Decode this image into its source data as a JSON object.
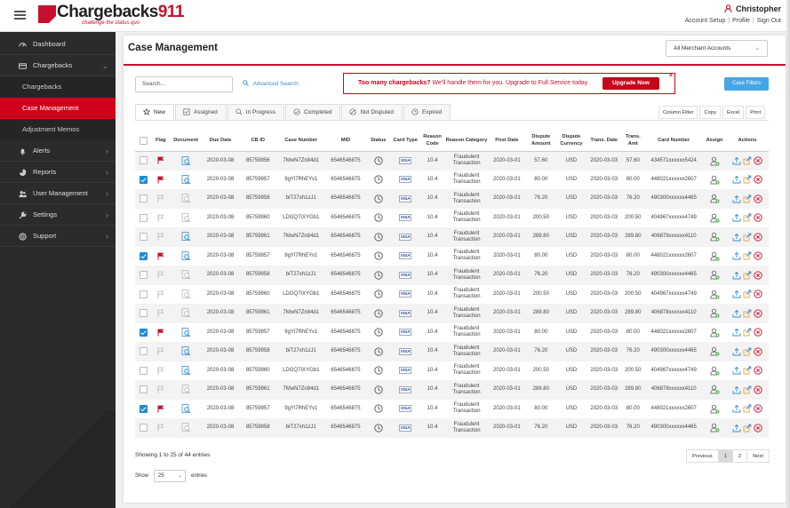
{
  "header": {
    "logo_text_a": "Chargebacks",
    "logo_text_b": "911",
    "logo_tagline": "challenge the status quo",
    "user_name": "Christopher",
    "links": [
      "Account Setup",
      "Profile",
      "Sign Out"
    ]
  },
  "sidebar": {
    "items": [
      {
        "label": "Dashboard",
        "icon": "dashboard-icon",
        "chevron": false
      },
      {
        "label": "Chargebacks",
        "icon": "chargebacks-icon",
        "chevron": true,
        "expanded": true
      },
      {
        "label": "Alerts",
        "icon": "bell-icon",
        "chevron": true
      },
      {
        "label": "Reports",
        "icon": "pie-chart-icon",
        "chevron": true
      },
      {
        "label": "User Management",
        "icon": "users-icon",
        "chevron": true
      },
      {
        "label": "Settings",
        "icon": "wrench-icon",
        "chevron": true
      },
      {
        "label": "Support",
        "icon": "lifebuoy-icon",
        "chevron": true
      }
    ],
    "sub_items": [
      {
        "label": "Chargebacks",
        "active": false
      },
      {
        "label": "Case Management",
        "active": true
      },
      {
        "label": "Adjustment Memos",
        "active": false
      }
    ]
  },
  "page": {
    "title": "Case Management",
    "merchant_select": "All Merchant Accounts",
    "search_placeholder": "Search...",
    "advanced_search": "Advanced Search",
    "promo_bold": "Too many chargebacks?",
    "promo_text": "We'll handle them for you. Upgrade to Full Service today",
    "upgrade_button": "Upgrade Now",
    "case_filters_button": "Case Filters"
  },
  "tabs": [
    "New",
    "Assigned",
    "In Progress",
    "Completed",
    "Not Disputed",
    "Expired"
  ],
  "tools": [
    "Column Filter",
    "Copy",
    "Excel",
    "Print"
  ],
  "table": {
    "columns": [
      "",
      "Flag",
      "Document",
      "Due Date",
      "CB ID",
      "Case Number",
      "MID",
      "Status",
      "Card Type",
      "Reason Code",
      "Reason Category",
      "Post Date",
      "Dispute Amount",
      "Dispute Currency",
      "Trans. Date",
      "Trans. Amt",
      "Card Number",
      "Assign",
      "Actions"
    ],
    "rows": [
      {
        "checked": false,
        "flagged": true,
        "doc": true,
        "due": "2020-03-08",
        "cbid": "85759956",
        "case": "7MwN7Zn84d1",
        "mid": "6546546875",
        "card": "VISA",
        "rcode": "10.4",
        "rcat": "Fraudulent Transaction",
        "post": "2020-03-01",
        "amount": "57.60",
        "currency": "USD",
        "tdate": "2020-03-03",
        "tamt": "57.60",
        "cardnum": "434571xxxxxx5424"
      },
      {
        "checked": true,
        "flagged": true,
        "doc": true,
        "due": "2020-03-08",
        "cbid": "85759957",
        "case": "9gYl7RhEYv1",
        "mid": "6546546875",
        "card": "VISA",
        "rcode": "10.4",
        "rcat": "Fraudulent Transaction",
        "post": "2020-03-01",
        "amount": "80.00",
        "currency": "USD",
        "tdate": "2020-03-03",
        "tamt": "80.00",
        "cardnum": "448021xxxxxx2607"
      },
      {
        "checked": false,
        "flagged": false,
        "doc": false,
        "due": "2020-03-08",
        "cbid": "85759958",
        "case": "biT27xh1zJ1",
        "mid": "6546546875",
        "card": "VISA",
        "rcode": "10.4",
        "rcat": "Fraudulent Transaction",
        "post": "2020-03-01",
        "amount": "76.20",
        "currency": "USD",
        "tdate": "2020-03-03",
        "tamt": "76.20",
        "cardnum": "490300xxxxxx4465"
      },
      {
        "checked": false,
        "flagged": false,
        "doc": false,
        "due": "2020-03-08",
        "cbid": "85759960",
        "case": "LDGQ7IXYGb1",
        "mid": "6546546875",
        "card": "VISA",
        "rcode": "10.4",
        "rcat": "Fraudulent Transaction",
        "post": "2020-03-01",
        "amount": "200.50",
        "currency": "USD",
        "tdate": "2020-03-03",
        "tamt": "200.50",
        "cardnum": "404967xxxxxx4749"
      },
      {
        "checked": false,
        "flagged": false,
        "doc": true,
        "due": "2020-03-08",
        "cbid": "85759961",
        "case": "7MwN7Zn84d1",
        "mid": "6546546875",
        "card": "VISA",
        "rcode": "10.4",
        "rcat": "Fraudulent Transaction",
        "post": "2020-03-01",
        "amount": "289.80",
        "currency": "USD",
        "tdate": "2020-03-03",
        "tamt": "289.80",
        "cardnum": "406878xxxxxx4110"
      },
      {
        "checked": true,
        "flagged": true,
        "doc": true,
        "due": "2020-03-08",
        "cbid": "85759957",
        "case": "9gYl7RhEYv1",
        "mid": "6546546875",
        "card": "VISA",
        "rcode": "10.4",
        "rcat": "Fraudulent Transaction",
        "post": "2020-03-01",
        "amount": "80.00",
        "currency": "USD",
        "tdate": "2020-03-03",
        "tamt": "80.00",
        "cardnum": "448021xxxxxx2607"
      },
      {
        "checked": false,
        "flagged": false,
        "doc": false,
        "due": "2020-03-08",
        "cbid": "85759958",
        "case": "biT27xh1zJ1",
        "mid": "6546546875",
        "card": "VISA",
        "rcode": "10.4",
        "rcat": "Fraudulent Transaction",
        "post": "2020-03-01",
        "amount": "76.20",
        "currency": "USD",
        "tdate": "2020-03-03",
        "tamt": "76.20",
        "cardnum": "490300xxxxxx4465"
      },
      {
        "checked": false,
        "flagged": false,
        "doc": false,
        "due": "2020-03-08",
        "cbid": "85759960",
        "case": "LDGQ7IXYGb1",
        "mid": "6546546875",
        "card": "VISA",
        "rcode": "10.4",
        "rcat": "Fraudulent Transaction",
        "post": "2020-03-01",
        "amount": "200.50",
        "currency": "USD",
        "tdate": "2020-03-03",
        "tamt": "200.50",
        "cardnum": "404967xxxxxx4749"
      },
      {
        "checked": false,
        "flagged": false,
        "doc": false,
        "due": "2020-03-08",
        "cbid": "85759961",
        "case": "7MwN7Zn84d1",
        "mid": "6546546875",
        "card": "VISA",
        "rcode": "10.4",
        "rcat": "Fraudulent Transaction",
        "post": "2020-03-01",
        "amount": "289.80",
        "currency": "USD",
        "tdate": "2020-03-03",
        "tamt": "289.80",
        "cardnum": "406878xxxxxx4110"
      },
      {
        "checked": true,
        "flagged": true,
        "doc": true,
        "due": "2020-03-08",
        "cbid": "85759957",
        "case": "9gYl7RhEYv1",
        "mid": "6546546875",
        "card": "VISA",
        "rcode": "10.4",
        "rcat": "Fraudulent Transaction",
        "post": "2020-03-01",
        "amount": "80.00",
        "currency": "USD",
        "tdate": "2020-03-03",
        "tamt": "80.00",
        "cardnum": "448021xxxxxx2607"
      },
      {
        "checked": false,
        "flagged": false,
        "doc": true,
        "due": "2020-03-08",
        "cbid": "85759958",
        "case": "biT27xh1zJ1",
        "mid": "6546546875",
        "card": "VISA",
        "rcode": "10.4",
        "rcat": "Fraudulent Transaction",
        "post": "2020-03-01",
        "amount": "76.20",
        "currency": "USD",
        "tdate": "2020-03-03",
        "tamt": "76.20",
        "cardnum": "490300xxxxxx4465"
      },
      {
        "checked": false,
        "flagged": false,
        "doc": true,
        "due": "2020-03-08",
        "cbid": "85759960",
        "case": "LDGQ7IXYGb1",
        "mid": "6546546875",
        "card": "VISA",
        "rcode": "10.4",
        "rcat": "Fraudulent Transaction",
        "post": "2020-03-01",
        "amount": "200.50",
        "currency": "USD",
        "tdate": "2020-03-03",
        "tamt": "200.50",
        "cardnum": "404967xxxxxx4749"
      },
      {
        "checked": false,
        "flagged": false,
        "doc": false,
        "due": "2020-03-08",
        "cbid": "85759961",
        "case": "7MwN7Zn84d1",
        "mid": "6546546875",
        "card": "VISA",
        "rcode": "10.4",
        "rcat": "Fraudulent Transaction",
        "post": "2020-03-01",
        "amount": "289.80",
        "currency": "USD",
        "tdate": "2020-03-03",
        "tamt": "289.80",
        "cardnum": "406878xxxxxx4110"
      },
      {
        "checked": true,
        "flagged": true,
        "doc": true,
        "due": "2020-03-08",
        "cbid": "85759957",
        "case": "9gYl7RhEYv1",
        "mid": "6546546875",
        "card": "VISA",
        "rcode": "10.4",
        "rcat": "Fraudulent Transaction",
        "post": "2020-03-01",
        "amount": "80.00",
        "currency": "USD",
        "tdate": "2020-03-03",
        "tamt": "80.00",
        "cardnum": "448021xxxxxx2607"
      },
      {
        "checked": false,
        "flagged": false,
        "doc": false,
        "due": "2020-03-08",
        "cbid": "85759958",
        "case": "biT27xh1zJ1",
        "mid": "6546546875",
        "card": "VISA",
        "rcode": "10.4",
        "rcat": "Fraudulent Transaction",
        "post": "2020-03-01",
        "amount": "76.20",
        "currency": "USD",
        "tdate": "2020-03-03",
        "tamt": "76.20",
        "cardnum": "490300xxxxxx4465"
      }
    ]
  },
  "footer": {
    "info": "Showing 1 to 25 of 44 entries",
    "show_label": "Show",
    "show_value": "25",
    "entries_label": "entries",
    "pager": [
      "Previous",
      "1",
      "2",
      "Next"
    ],
    "current_page": "1"
  },
  "colors": {
    "accent": "#c8102e",
    "button_blue": "#45a6e6",
    "checkbox_blue": "#1e8ad6",
    "sidebar": "#2b2b2b"
  }
}
